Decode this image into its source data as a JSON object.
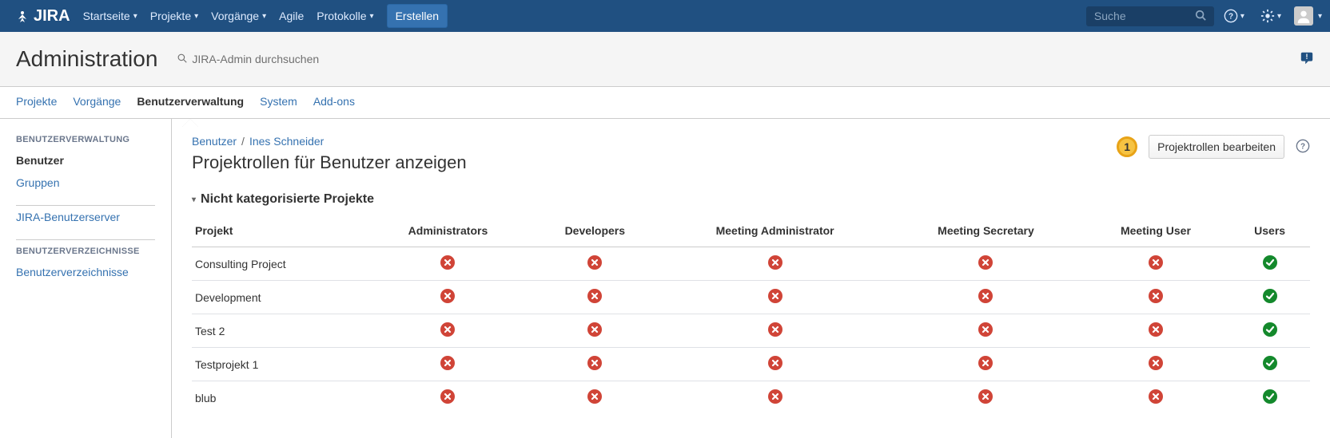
{
  "nav": {
    "logo_text": "JIRA",
    "items": [
      {
        "label": "Startseite",
        "has_dropdown": true
      },
      {
        "label": "Projekte",
        "has_dropdown": true
      },
      {
        "label": "Vorgänge",
        "has_dropdown": true
      },
      {
        "label": "Agile",
        "has_dropdown": false
      },
      {
        "label": "Protokolle",
        "has_dropdown": true
      }
    ],
    "create_label": "Erstellen",
    "search_placeholder": "Suche"
  },
  "admin": {
    "title": "Administration",
    "search_placeholder": "JIRA-Admin durchsuchen",
    "tabs": [
      {
        "label": "Projekte",
        "active": false
      },
      {
        "label": "Vorgänge",
        "active": false
      },
      {
        "label": "Benutzerverwaltung",
        "active": true
      },
      {
        "label": "System",
        "active": false
      },
      {
        "label": "Add-ons",
        "active": false
      }
    ]
  },
  "sidebar": {
    "groups": [
      {
        "heading": "BENUTZERVERWALTUNG",
        "items": [
          {
            "label": "Benutzer",
            "active": true
          },
          {
            "label": "Gruppen",
            "active": false
          }
        ]
      },
      {
        "heading": "",
        "items": [
          {
            "label": "JIRA-Benutzerserver",
            "active": false
          }
        ]
      },
      {
        "heading": "BENUTZERVERZEICHNISSE",
        "items": [
          {
            "label": "Benutzerverzeichnisse",
            "active": false
          }
        ]
      }
    ]
  },
  "content": {
    "breadcrumbs": [
      {
        "label": "Benutzer"
      },
      {
        "label": "Ines Schneider"
      }
    ],
    "page_title": "Projektrollen für Benutzer anzeigen",
    "badge_number": "1",
    "action_button": "Projektrollen bearbeiten",
    "section_title": "Nicht kategorisierte Projekte",
    "columns": [
      "Projekt",
      "Administrators",
      "Developers",
      "Meeting Administrator",
      "Meeting Secretary",
      "Meeting User",
      "Users"
    ],
    "rows": [
      {
        "project": "Consulting Project",
        "roles": [
          false,
          false,
          false,
          false,
          false,
          true
        ]
      },
      {
        "project": "Development",
        "roles": [
          false,
          false,
          false,
          false,
          false,
          true
        ]
      },
      {
        "project": "Test 2",
        "roles": [
          false,
          false,
          false,
          false,
          false,
          true
        ]
      },
      {
        "project": "Testprojekt 1",
        "roles": [
          false,
          false,
          false,
          false,
          false,
          true
        ]
      },
      {
        "project": "blub",
        "roles": [
          false,
          false,
          false,
          false,
          false,
          true
        ]
      }
    ],
    "colors": {
      "yes": "#14892c",
      "no": "#d04437"
    }
  }
}
